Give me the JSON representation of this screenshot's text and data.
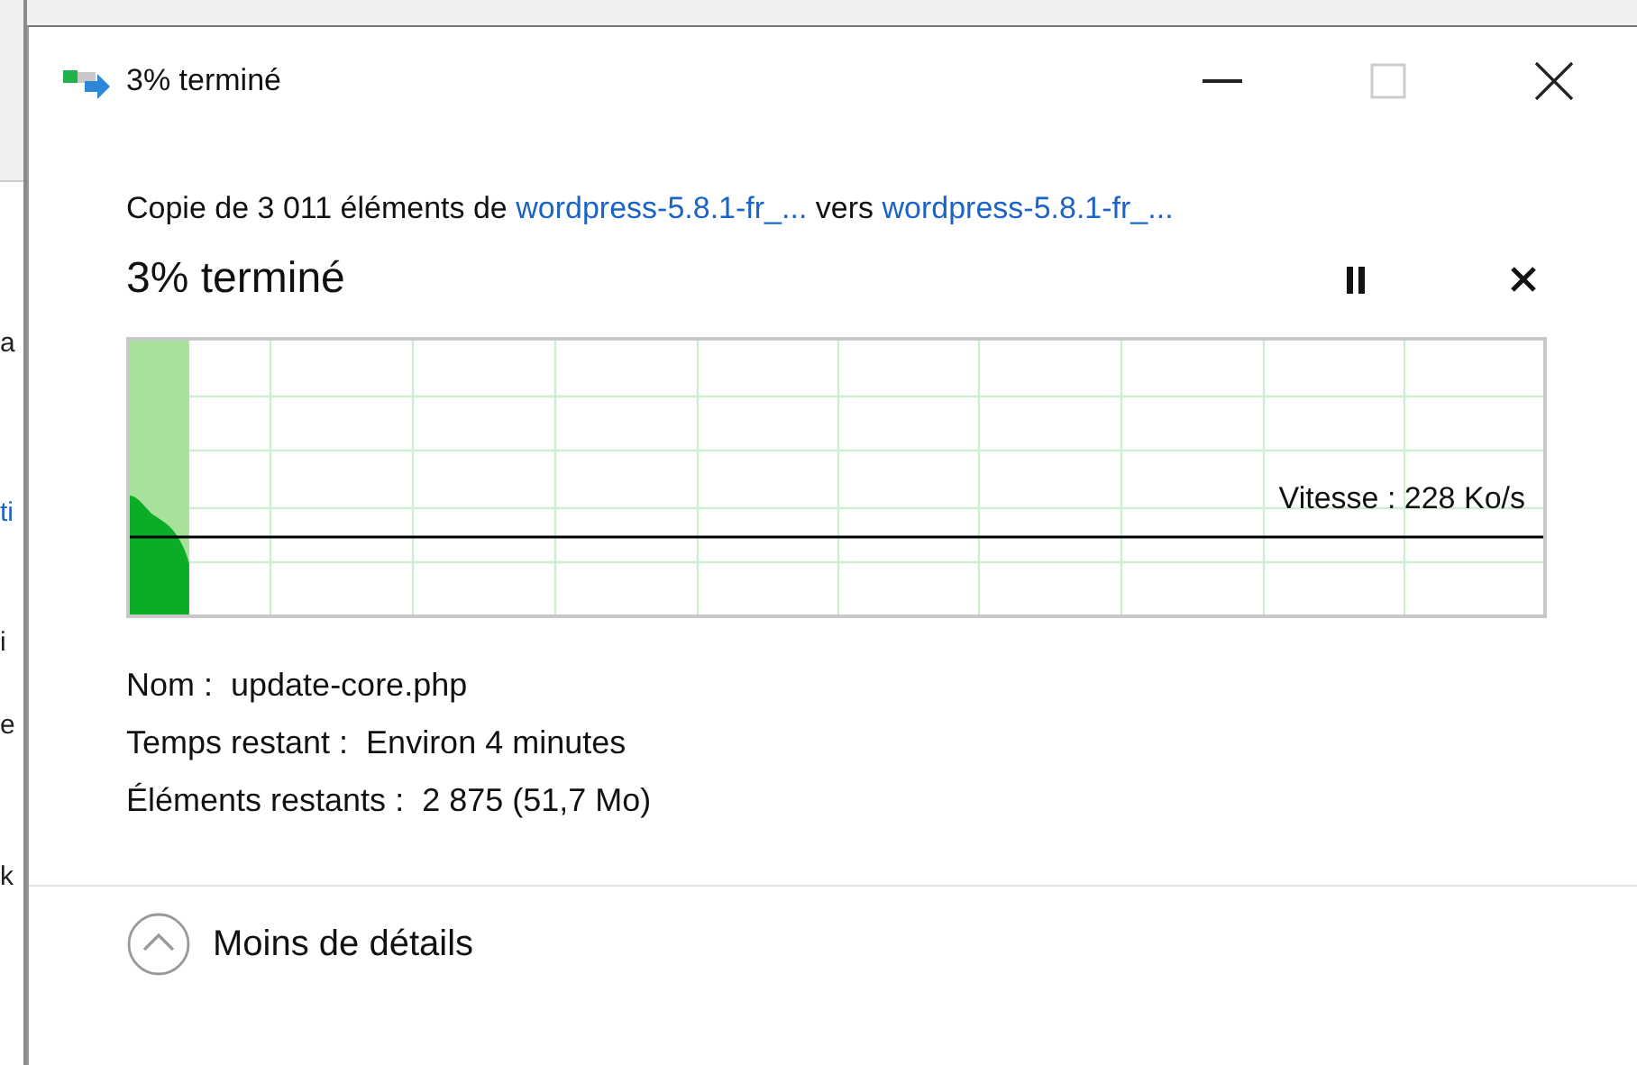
{
  "background_window": {
    "fragments": [
      "a",
      "ti",
      "i",
      "e",
      "k"
    ]
  },
  "window": {
    "title": "3% terminé"
  },
  "header": {
    "parts": [
      {
        "kind": "text",
        "text": "Copie de 3 011 éléments de "
      },
      {
        "kind": "link",
        "text": "wordpress-5.8.1-fr_..."
      },
      {
        "kind": "text",
        "text": " vers "
      },
      {
        "kind": "link",
        "text": "wordpress-5.8.1-fr_..."
      }
    ]
  },
  "progress": {
    "heading": "3% terminé",
    "level": 0.042,
    "paused": false
  },
  "graph": {
    "speed": "Vitesse : 228 Ko/s"
  },
  "details": [
    {
      "label": "Nom :",
      "value": "update-core.php"
    },
    {
      "label": "Temps restant :",
      "value": "Environ 4 minutes"
    },
    {
      "label": "Éléments restants :",
      "value": "2 875 (51,7 Mo)"
    }
  ],
  "footer": {
    "toggle": "Moins de détails",
    "expanded": true
  }
}
